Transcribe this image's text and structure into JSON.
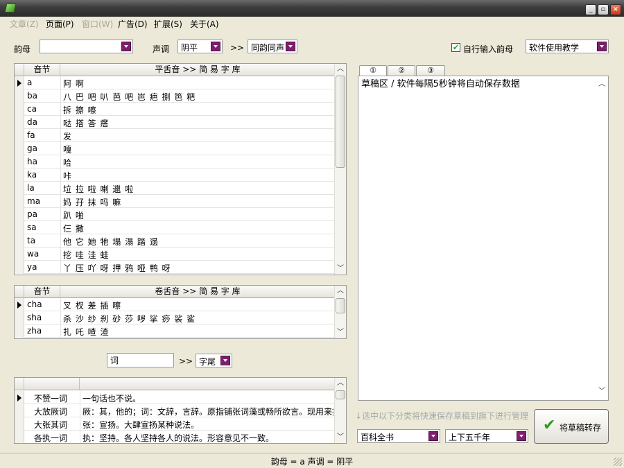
{
  "menu": [
    {
      "label": "文章(Z)",
      "disabled": true
    },
    {
      "label": "页面(P)",
      "disabled": false
    },
    {
      "label": "窗口(W)",
      "disabled": true
    },
    {
      "label": "广告(D)",
      "disabled": false
    },
    {
      "label": "扩展(S)",
      "disabled": false
    },
    {
      "label": "关于(A)",
      "disabled": false
    }
  ],
  "filters": {
    "rhyme_label": "韵母",
    "rhyme_value": "",
    "tone_label": "声调",
    "tone_value": "阴平",
    "arrow": ">>",
    "same_rhyme_value": "同韵同声",
    "auto_input_label": "自行输入韵母",
    "auto_input_checked": true,
    "tutorial_value": "软件使用教学"
  },
  "flat_table": {
    "header_syllable": "音节",
    "header_title": "平舌音 >> 简 易 字 库",
    "rows": [
      {
        "syllable": "a",
        "chars": "阿 啊",
        "current": true
      },
      {
        "syllable": "ba",
        "chars": "八 巴 吧 叭 芭 吧 岜 疤 捌 笆 粑"
      },
      {
        "syllable": "ca",
        "chars": "拆 擦 嚓"
      },
      {
        "syllable": "da",
        "chars": "哒 搭 答 瘩"
      },
      {
        "syllable": "fa",
        "chars": "发"
      },
      {
        "syllable": "ga",
        "chars": "嘎"
      },
      {
        "syllable": "ha",
        "chars": "哈"
      },
      {
        "syllable": "ka",
        "chars": "咔"
      },
      {
        "syllable": "la",
        "chars": "垃 拉 啦 喇 邋 啦"
      },
      {
        "syllable": "ma",
        "chars": "妈 孖 抹 吗 嘛"
      },
      {
        "syllable": "pa",
        "chars": "趴 啪"
      },
      {
        "syllable": "sa",
        "chars": "仨 撒"
      },
      {
        "syllable": "ta",
        "chars": "他 它 她 牠 塌 溻 踏 遢"
      },
      {
        "syllable": "wa",
        "chars": "挖 哇 洼 蛙"
      },
      {
        "syllable": "ya",
        "chars": "丫 压 吖 呀 押 鸦 哑 鸭 呀"
      }
    ]
  },
  "curled_table": {
    "header_syllable": "音节",
    "header_title": "卷舌音 >> 简 易 字 库",
    "rows": [
      {
        "syllable": "cha",
        "chars": "叉 杈 差 插 嚓",
        "current": true
      },
      {
        "syllable": "sha",
        "chars": "杀 沙 纱 刹 砂 莎 哕 挲 痧 裟 鲨"
      },
      {
        "syllable": "zha",
        "chars": "扎 吒 喳 渣"
      }
    ]
  },
  "word_search": {
    "value": "词",
    "arrow": ">>",
    "mode_value": "字尾"
  },
  "idiom_table": {
    "rows": [
      {
        "word": "不赞一词",
        "meaning": "一句话也不说。",
        "current": true
      },
      {
        "word": "大放厥词",
        "meaning": "厥：其，他的；词：文辞，言辞。原指铺张词藻或畅所欲言。现用来抨"
      },
      {
        "word": "大张其词",
        "meaning": "张：宣扬。大肆宣扬某种说法。"
      },
      {
        "word": "各执一词",
        "meaning": "执：坚持。各人坚持各人的说法。形容意见不一致。"
      }
    ]
  },
  "draft": {
    "tabs": [
      "①",
      "②",
      "③"
    ],
    "active_tab": 0,
    "text": "草稿区 / 软件每隔5秒钟将自动保存数据"
  },
  "save_area": {
    "hint": "↓选中以下分类将快速保存草稿到旗下进行管理",
    "category_value": "百科全书",
    "subcategory_value": "上下五千年",
    "save_button_label": "将草稿转存"
  },
  "status": {
    "text": "韵母 = a    声调 = 阴平"
  }
}
